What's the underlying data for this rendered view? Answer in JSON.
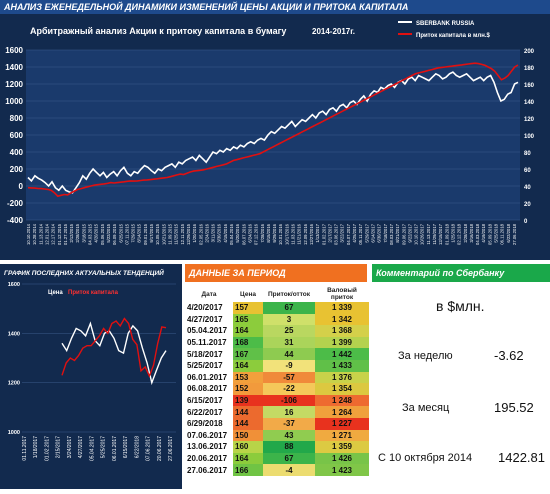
{
  "header": {
    "title": "АНАЛИЗ  ЕЖЕНЕДЕЛЬНОЙ ДИНАМИКИ ИЗМЕНЕНИЙ  ЦЕНЫ АКЦИИ И ПРИТОКА КАПИТАЛА"
  },
  "main_chart": {
    "title": "Арбитражный анализ Акции к притоку капитала в бумагу",
    "period": "2014-2017г."
  },
  "sub_chart": {
    "title": "ГРАФИК ПОСЛЕДНИХ АКТУАЛЬНЫХ ТЕНДЕНЦИЙ"
  },
  "data_panel": {
    "title": "ДАННЫЕ ЗА ПЕРИОД",
    "headers": {
      "date": "Дата",
      "price": "Цена",
      "flow": "Приток/отток",
      "gross": "Валовый приток"
    },
    "rows": [
      {
        "date": "4/20/2017",
        "price": "157",
        "flow": "67",
        "gross": "1 339",
        "price_bg": "#e8c232",
        "flow_bg": "#3cb44a",
        "gross_bg": "#e8c232"
      },
      {
        "date": "4/27/2017",
        "price": "165",
        "flow": "3",
        "gross": "1 342",
        "price_bg": "#8ccc3c",
        "flow_bg": "#cfe06a",
        "gross_bg": "#e8c232"
      },
      {
        "date": "05.04.2017",
        "price": "164",
        "flow": "25",
        "gross": "1 368",
        "price_bg": "#8ccc3c",
        "flow_bg": "#b9d760",
        "gross_bg": "#d4d04a"
      },
      {
        "date": "05.11.2017",
        "price": "168",
        "flow": "31",
        "gross": "1 399",
        "price_bg": "#4cbc48",
        "flow_bg": "#abd45a",
        "gross_bg": "#b4d24e"
      },
      {
        "date": "5/18/2017",
        "price": "167",
        "flow": "44",
        "gross": "1 442",
        "price_bg": "#60c048",
        "flow_bg": "#8ecb50",
        "gross_bg": "#4cbc48"
      },
      {
        "date": "5/25/2017",
        "price": "164",
        "flow": "-9",
        "gross": "1 433",
        "price_bg": "#8ccc3c",
        "flow_bg": "#f2e27a",
        "gross_bg": "#60c048"
      },
      {
        "date": "06.01.2017",
        "price": "153",
        "flow": "-57",
        "gross": "1 376",
        "price_bg": "#f2a03c",
        "flow_bg": "#f08a3a",
        "gross_bg": "#c8d24a"
      },
      {
        "date": "06.08.2017",
        "price": "152",
        "flow": "-22",
        "gross": "1 354",
        "price_bg": "#f29a3c",
        "flow_bg": "#f4c85a",
        "gross_bg": "#dcc840"
      },
      {
        "date": "6/15/2017",
        "price": "139",
        "flow": "-106",
        "gross": "1 248",
        "price_bg": "#e8321e",
        "flow_bg": "#e8321e",
        "gross_bg": "#ee6a30"
      },
      {
        "date": "6/22/2017",
        "price": "144",
        "flow": "16",
        "gross": "1 264",
        "price_bg": "#ec6a2e",
        "flow_bg": "#c4da64",
        "gross_bg": "#f0a03c"
      },
      {
        "date": "6/29/2018",
        "price": "144",
        "flow": "-37",
        "gross": "1 227",
        "price_bg": "#ec6a2e",
        "flow_bg": "#f2aa48",
        "gross_bg": "#e8321e"
      },
      {
        "date": "07.06.2017",
        "price": "150",
        "flow": "43",
        "gross": "1 271",
        "price_bg": "#f09038",
        "flow_bg": "#90cc50",
        "gross_bg": "#f0aa40"
      },
      {
        "date": "13.06.2017",
        "price": "160",
        "flow": "88",
        "gross": "1 359",
        "price_bg": "#b8d448",
        "flow_bg": "#22a84a",
        "gross_bg": "#dcca42"
      },
      {
        "date": "20.06.2017",
        "price": "164",
        "flow": "67",
        "gross": "1 426",
        "price_bg": "#8ccc3c",
        "flow_bg": "#3cb44a",
        "gross_bg": "#78c448"
      },
      {
        "date": "27.06.2017",
        "price": "166",
        "flow": "-4",
        "gross": "1 423",
        "price_bg": "#70c444",
        "flow_bg": "#ecdc70",
        "gross_bg": "#80c648"
      }
    ]
  },
  "comment_panel": {
    "title": "Комментарий по Сбербанку",
    "unit": "в $млн.",
    "items": [
      {
        "label": "За неделю",
        "value": "-3.62"
      },
      {
        "label": "За месяц",
        "value": "195.52"
      },
      {
        "label": "С 10 октября 2014",
        "value": "1422.81"
      }
    ]
  },
  "colors": {
    "header_bg": "#1e4a8c",
    "chart_bg": "#122a4e",
    "price_line": "#ffffff",
    "flow_line": "#e01010",
    "orange": "#f07020",
    "green": "#1aa84a"
  },
  "chart_data": [
    {
      "type": "line",
      "title": "Арбитражный анализ Акции к притоку капитала в бумагу",
      "subtitle": "2014-2017г.",
      "ylim_left": [
        -400,
        1600
      ],
      "ylim_right": [
        0,
        200
      ],
      "left_ticks": [
        "1600",
        "1400",
        "1200",
        "1000",
        "800",
        "600",
        "400",
        "200",
        "0",
        "-200",
        "-400"
      ],
      "right_ticks": [
        "200",
        "180",
        "160",
        "140",
        "120",
        "100",
        "80",
        "60",
        "40",
        "20",
        "0"
      ],
      "x_ticks": [
        "10.10.2014",
        "10.28.2014",
        "11.13.2014",
        "12.01.2014",
        "12.17.2014",
        "01.12.2015",
        "01.27.2015",
        "2/12/2015",
        "2/28/2015",
        "3/18/2015",
        "04.03.2015",
        "4/20/2015",
        "05.06.2015",
        "5/22/2015",
        "06.09.2015",
        "6/25/2015",
        "07.11.2015",
        "7/29/2015",
        "8/14/2015",
        "09.01.2015",
        "9/17/2015",
        "10.05.2015",
        "10/21/2015",
        "11.09.2015",
        "11/25/2015",
        "12.11.2015",
        "12/29/2015",
        "1/20/2016",
        "02.05.2016",
        "2/24/2016",
        "3/11/2016",
        "3/30/2016",
        "4/15/2016",
        "05.04.2016",
        "5/20/2016",
        "06.07.2016",
        "6/24/2016",
        "07.12.2016",
        "7/28/2016",
        "8/15/2016",
        "9/29/2016",
        "10.01.2016",
        "10/17/2016",
        "11.03.2016",
        "11/21/2016",
        "12.09.2016",
        "12/27/2016",
        "1/13/2017",
        "01.02.2017",
        "2/17/2017",
        "03.06.2017",
        "3/22/2017",
        "04.07.2017",
        "4/25/2017",
        "05.11.2017",
        "5/29/2017",
        "6/14/2017",
        "6/30/2017",
        "7/18/2017",
        "08.03.2017",
        "8/21/2017",
        "09.06.2017",
        "9/22/2017",
        "10.10.2017",
        "10/26/2017",
        "11.13.2017",
        "11/29/2017",
        "12/15/2017",
        "01.09.2018",
        "1/25/2018",
        "02.12.2018",
        "2/28/2018",
        "3/16/2018",
        "04.03.2018",
        "4/19/2018",
        "05.09.2018",
        "5/25/2018",
        "06.11.2018",
        "6/22/2018",
        "27.06.2018"
      ],
      "series": [
        {
          "name": "SBERBANK RUSSIA",
          "axis": "right",
          "values": [
            50,
            46,
            52,
            49,
            47,
            44,
            40,
            45,
            38,
            35,
            40,
            35,
            33,
            32,
            38,
            44,
            52,
            48,
            55,
            60,
            56,
            52,
            56,
            50,
            54,
            57,
            52,
            58,
            62,
            55,
            52,
            57,
            55,
            60,
            64,
            62,
            58,
            55,
            60,
            58,
            62,
            64,
            66,
            62,
            68,
            66,
            70,
            72,
            74,
            70,
            76,
            72,
            68,
            74,
            80,
            78,
            82,
            80,
            84,
            82,
            86,
            84,
            88,
            86,
            90,
            92,
            90,
            94,
            96,
            94,
            100,
            104,
            102,
            106,
            110,
            108,
            112,
            116,
            110,
            114,
            118,
            116,
            120,
            124,
            120,
            126,
            128,
            124,
            130,
            132,
            128,
            134,
            136,
            132,
            138,
            140,
            136,
            142,
            146,
            140,
            148,
            152,
            150,
            156,
            154,
            158,
            160,
            156,
            162,
            164,
            160,
            166,
            168,
            164,
            170,
            168,
            166,
            164,
            168,
            172,
            170,
            166,
            168,
            172,
            174,
            170,
            168,
            170,
            172,
            168,
            164,
            166,
            168,
            164,
            168,
            170,
            162,
            150,
            140,
            142,
            148,
            150,
            160,
            162
          ]
        },
        {
          "name": "Приток капитала в млн.$",
          "axis": "left",
          "values": [
            -20,
            -22,
            -25,
            -28,
            -30,
            -35,
            -40,
            -50,
            -80,
            -120,
            -110,
            -100,
            -105,
            -80,
            -60,
            -40,
            -30,
            -20,
            -10,
            0,
            10,
            15,
            20,
            25,
            30,
            40,
            35,
            40,
            45,
            50,
            55,
            60,
            58,
            60,
            65,
            70,
            72,
            75,
            80,
            85,
            90,
            95,
            100,
            110,
            120,
            130,
            140,
            135,
            150,
            165,
            175,
            180,
            185,
            190,
            200,
            210,
            220,
            230,
            240,
            250,
            260,
            280,
            300,
            310,
            320,
            330,
            340,
            350,
            360,
            370,
            380,
            400,
            420,
            440,
            460,
            480,
            500,
            520,
            540,
            560,
            580,
            600,
            620,
            640,
            660,
            680,
            700,
            720,
            740,
            760,
            780,
            800,
            820,
            840,
            860,
            880,
            900,
            920,
            940,
            960,
            980,
            1000,
            1020,
            1040,
            1060,
            1080,
            1100,
            1120,
            1140,
            1160,
            1180,
            1200,
            1220,
            1240,
            1260,
            1280,
            1300,
            1320,
            1330,
            1340,
            1350,
            1360,
            1370,
            1380,
            1390,
            1395,
            1400,
            1405,
            1410,
            1415,
            1420,
            1425,
            1430,
            1435,
            1440,
            1445,
            1440,
            1430,
            1420,
            1400,
            1380,
            1350,
            1300,
            1250,
            1270,
            1300,
            1350,
            1400,
            1423
          ]
        }
      ],
      "legend": "top-right",
      "grid": true
    },
    {
      "type": "line",
      "title": "ГРАФИК ПОСЛЕДНИХ АКТУАЛЬНЫХ ТЕНДЕНЦИЙ",
      "ylim": [
        1000,
        1600
      ],
      "y_ticks": [
        "1600",
        "1400",
        "1200",
        "1000"
      ],
      "x_ticks": [
        "01.11.2017",
        "1/18/2017",
        "01.02.2017",
        "2/15/2017",
        "3/24/2017",
        "4/27/2017",
        "05.04.2017",
        "5/25/2017",
        "06.01.2017",
        "6/15/2017",
        "6/22/2018",
        "07.06.2017",
        "20.06.2017",
        "27.06.2017"
      ],
      "series": [
        {
          "name": "Цена",
          "values": [
            1360,
            1330,
            1380,
            1420,
            1410,
            1390,
            1440,
            1370,
            1350,
            1400,
            1410,
            1380,
            1330,
            1320,
            1400,
            1430,
            1410,
            1340,
            1280,
            1200,
            1250,
            1300,
            1330
          ]
        },
        {
          "name": "Приток капитала",
          "values": [
            1230,
            1280,
            1300,
            1290,
            1310,
            1340,
            1350,
            1350,
            1370,
            1390,
            1420,
            1400,
            1440,
            1450,
            1430,
            1460,
            1440,
            1376,
            1354,
            1248,
            1264,
            1227,
            1271,
            1359,
            1426,
            1423
          ]
        }
      ],
      "legend": "top-center",
      "grid": true
    }
  ]
}
